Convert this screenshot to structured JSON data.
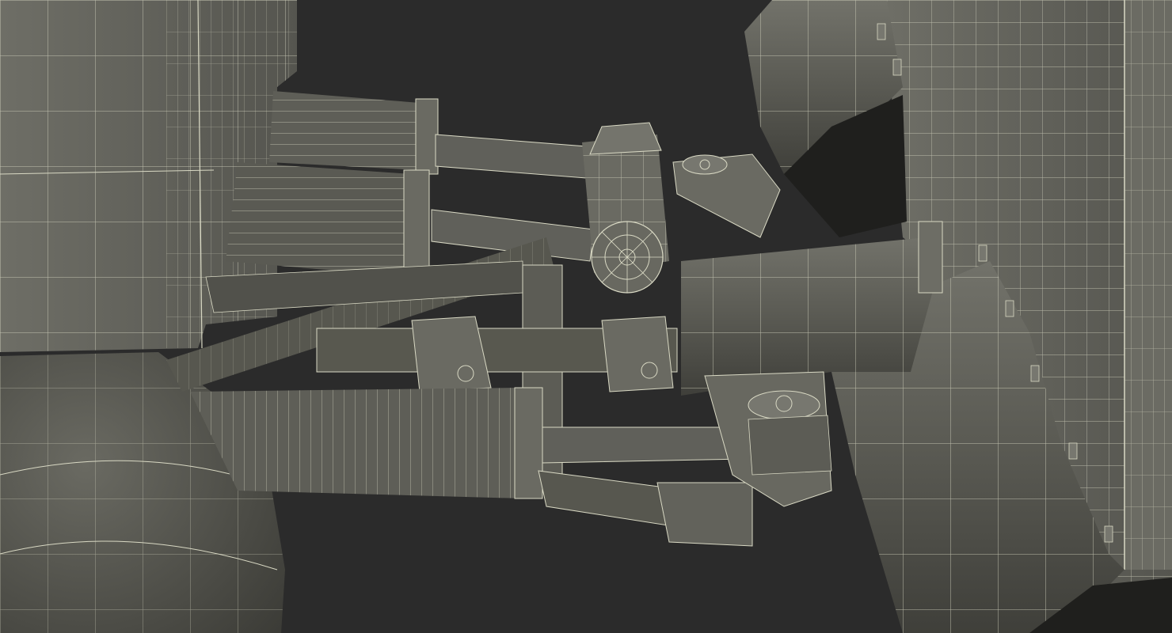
{
  "scene": {
    "subject": "wireframe-render",
    "background_color": "#2b2b2b",
    "mesh_fill_color": "#5c5c55",
    "mesh_fill_light": "#74746c",
    "mesh_fill_dark": "#45453f",
    "wire_color": "#d9d9c4"
  }
}
